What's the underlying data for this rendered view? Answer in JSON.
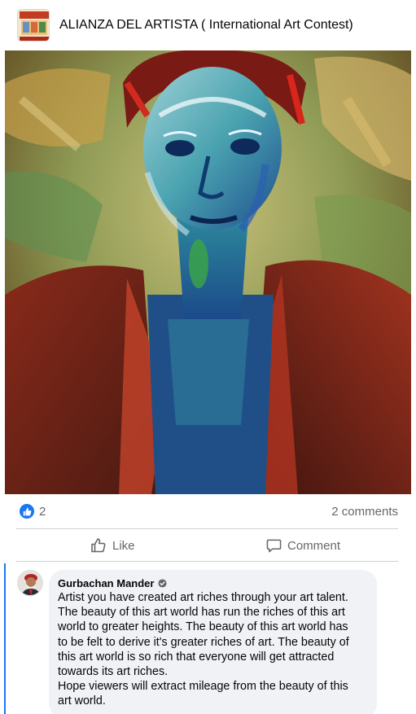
{
  "post": {
    "group_title": "ALIANZA DEL ARTISTA ( International Art Contest)",
    "group_avatar_icon": "group-logo",
    "image_alt": "Painting",
    "reactions": {
      "icon": "like-icon",
      "count": "2",
      "comments_label": "2 comments"
    },
    "actions": {
      "like_label": "Like",
      "comment_label": "Comment"
    }
  },
  "comment": {
    "author": "Gurbachan Mander",
    "verified_icon": "verified-badge-icon",
    "lines": [
      "Artist you have created art riches through your art talent.",
      "The beauty of this art world has run the riches of this art",
      "world to greater heights. The beauty of this art world has",
      "to be felt to derive it's greater riches of art. The beauty of",
      "this art world is so rich that everyone will get attracted",
      "towards its art riches.",
      "Hope viewers will extract mileage from the beauty of this",
      "art world."
    ]
  },
  "colors": {
    "accent": "#1877f2",
    "secondary_text": "#65676b",
    "bubble": "#f0f2f5"
  }
}
